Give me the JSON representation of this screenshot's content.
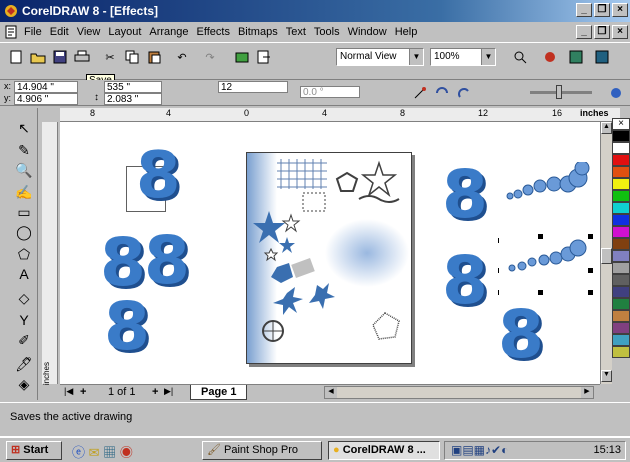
{
  "window": {
    "title": "CorelDRAW 8 - [Effects]",
    "minimize": "_",
    "restore": "8",
    "close": "×"
  },
  "menu": [
    "File",
    "Edit",
    "View",
    "Layout",
    "Arrange",
    "Effects",
    "Bitmaps",
    "Text",
    "Tools",
    "Window",
    "Help"
  ],
  "toolbar": {
    "view_mode": "Normal View",
    "zoom": "100%",
    "tooltip": "Save"
  },
  "properties": {
    "x": "14.904 \"",
    "y": "4.906 \"",
    "w": "535 \"",
    "h": "2.083 \"",
    "scale": "12",
    "angle": "0.0 °"
  },
  "ruler": {
    "labels": [
      "8",
      "4",
      "0",
      "4",
      "8",
      "12",
      "16"
    ],
    "units": "inches"
  },
  "vruler_units": "inches",
  "page_nav": {
    "counter": "1 of 1",
    "tab": "Page 1"
  },
  "status": "Saves the active drawing",
  "taskbar": {
    "start": "Start",
    "tasks": [
      "Paint Shop Pro",
      "CorelDRAW 8 ..."
    ],
    "clock": "15:13"
  },
  "canvas": {
    "glyph": "8"
  },
  "colors": {
    "accent_blue": "#3a7bc8",
    "title_blue": "#0a246a"
  }
}
